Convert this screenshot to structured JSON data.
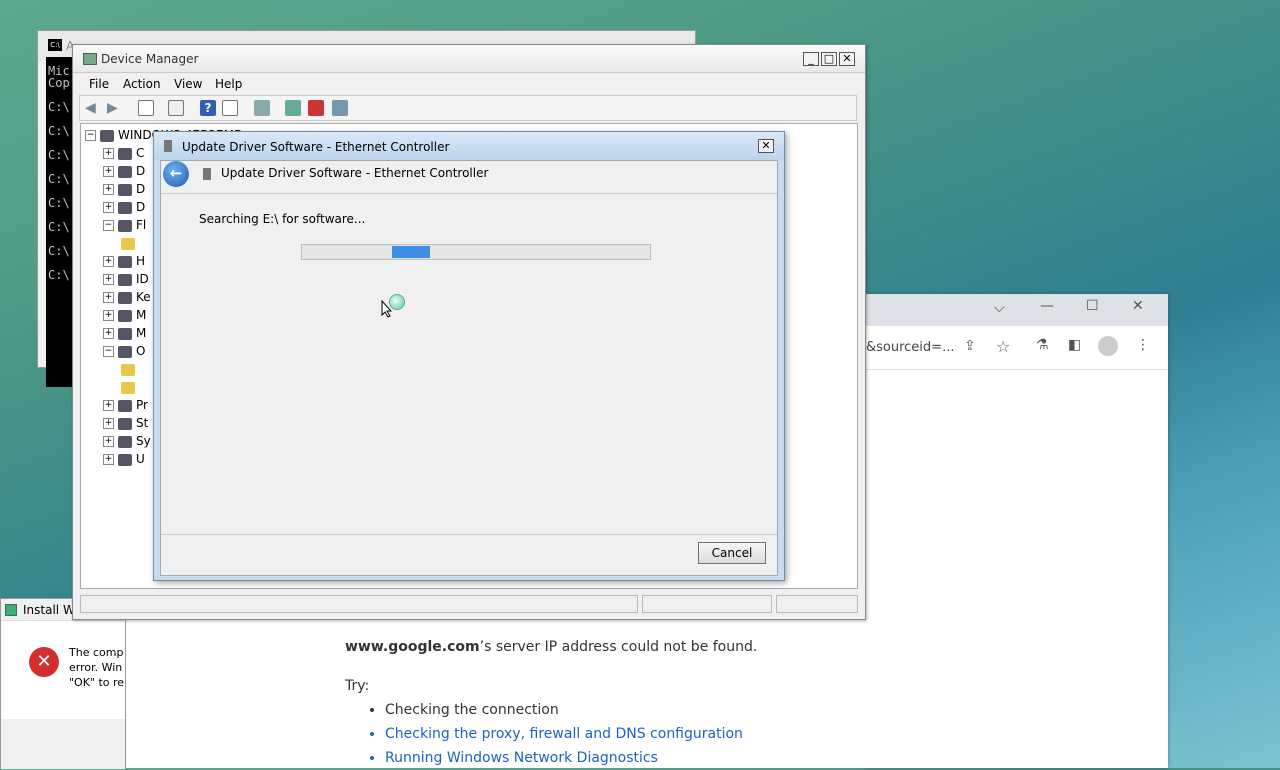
{
  "cmd": {
    "title_icon": "C:\\",
    "title_fragment": "A",
    "lines": [
      "Mic",
      "Cop",
      "",
      "C:\\",
      "C:\\",
      "C:\\",
      "C:\\",
      "C:\\",
      "C:\\",
      "C:\\",
      "C:\\"
    ]
  },
  "device_manager": {
    "title": "Device Manager",
    "menu": [
      "File",
      "Action",
      "View",
      "Help"
    ],
    "root": "WINDOWS-47B27MB",
    "tree_items": [
      {
        "letter": "C",
        "expander": "+"
      },
      {
        "letter": "D",
        "expander": "+"
      },
      {
        "letter": "D",
        "expander": "+"
      },
      {
        "letter": "D",
        "expander": "+"
      },
      {
        "letter": "Fl",
        "expander": "-"
      },
      {
        "letter": "",
        "expander": ""
      },
      {
        "letter": "H",
        "expander": "+"
      },
      {
        "letter": "ID",
        "expander": "+"
      },
      {
        "letter": "Ke",
        "expander": "+"
      },
      {
        "letter": "M",
        "expander": "+"
      },
      {
        "letter": "M",
        "expander": "+"
      },
      {
        "letter": "O",
        "expander": "-"
      },
      {
        "letter": "",
        "expander": ""
      },
      {
        "letter": "",
        "expander": ""
      },
      {
        "letter": "Pr",
        "expander": "+"
      },
      {
        "letter": "St",
        "expander": "+"
      },
      {
        "letter": "Sy",
        "expander": "+"
      },
      {
        "letter": "U",
        "expander": "+"
      }
    ]
  },
  "update_dialog": {
    "title": "Update Driver Software - Ethernet Controller",
    "header": "Update Driver Software - Ethernet Controller",
    "status": "Searching E:\\ for software...",
    "progress_start": 0.26,
    "progress_width": 0.11,
    "cancel_label": "Cancel"
  },
  "install_dialog": {
    "title": "Install Wi",
    "message_lines": [
      "The comp",
      "error. Win",
      "\"OK\" to re"
    ]
  },
  "chrome": {
    "address_fragment": "&sourceid=...",
    "error_host": "www.google.com",
    "error_rest": "’s server IP address could not be found.",
    "try_label": "Try:",
    "suggestions": [
      {
        "text": "Checking the connection",
        "link": false
      },
      {
        "text": "Checking the proxy, firewall and DNS configuration",
        "link": true
      },
      {
        "text": "Running Windows Network Diagnostics",
        "link": true
      }
    ]
  },
  "colors": {
    "link": "#1a62c5",
    "progress": "#3d8ee6",
    "error": "#d32f2f"
  }
}
